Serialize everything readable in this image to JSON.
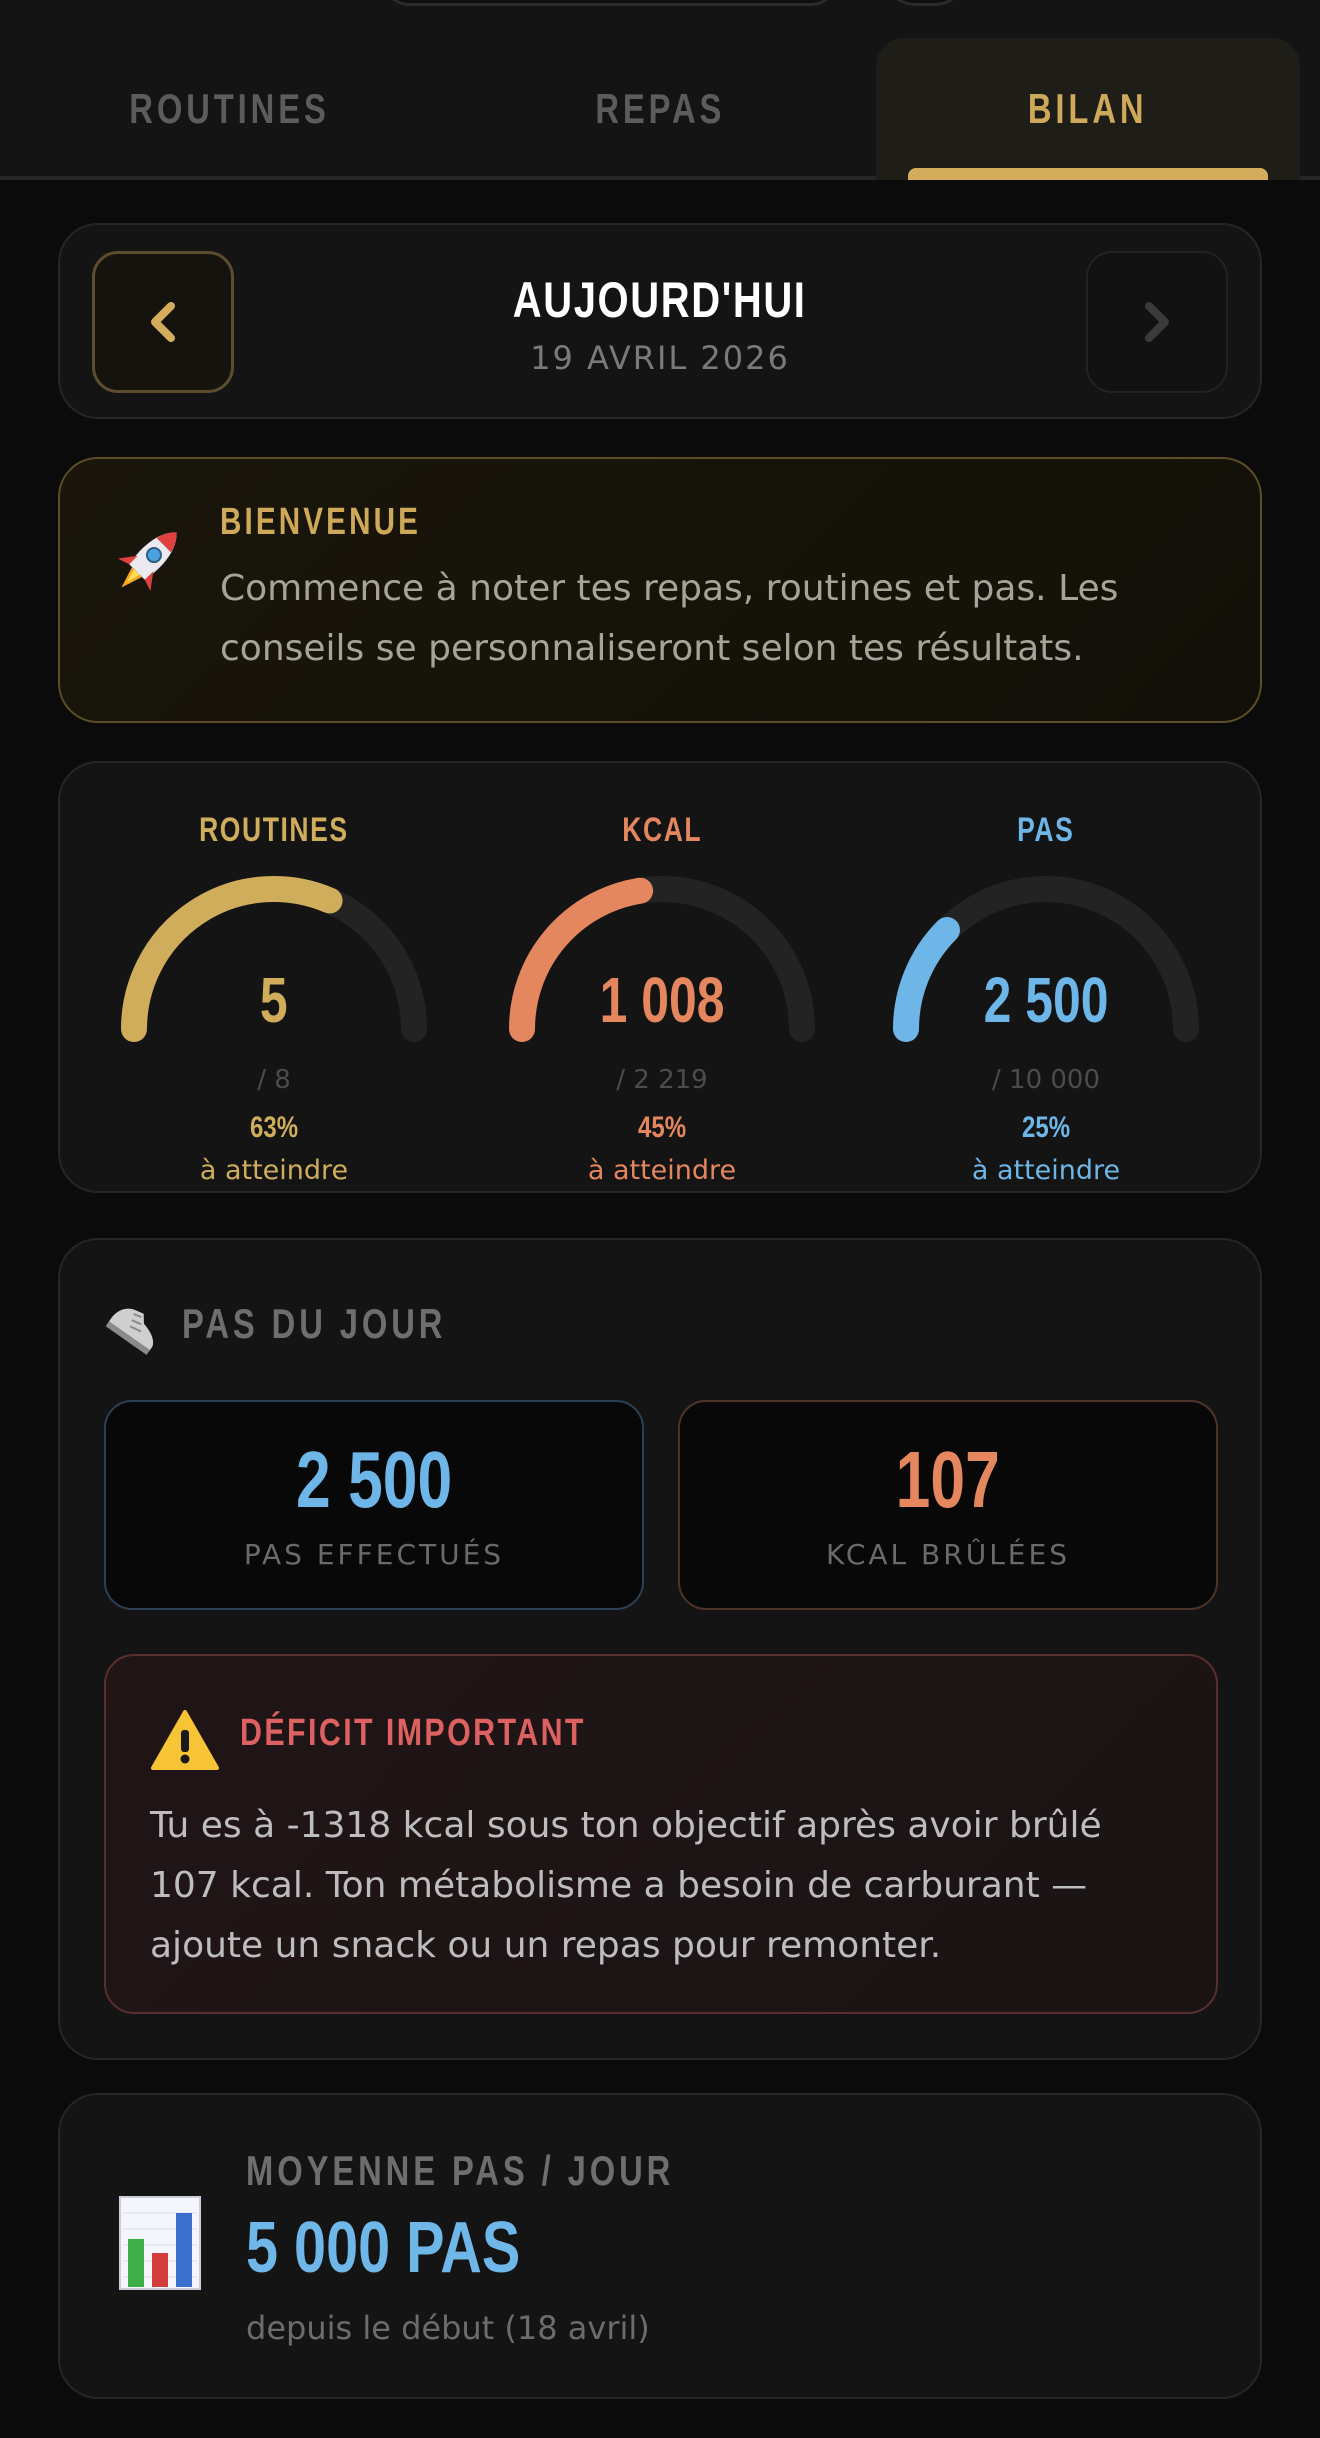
{
  "tabs": [
    {
      "label": "ROUTINES"
    },
    {
      "label": "REPAS"
    },
    {
      "label": "BILAN"
    }
  ],
  "date_nav": {
    "title": "AUJOURD'HUI",
    "date": "19 AVRIL 2026",
    "prev_icon": "chevron-left-icon",
    "next_icon": "chevron-right-icon"
  },
  "welcome": {
    "icon": "rocket-icon",
    "title": "BIENVENUE",
    "text": "Commence à noter tes repas, routines et pas. Les conseils se personnaliseront selon tes résultats."
  },
  "gauges": [
    {
      "label": "ROUTINES",
      "value": "5",
      "target": "/ 8",
      "percent_label": "63%",
      "hint": "à atteindre",
      "percent": 63,
      "color": "#cfad5b"
    },
    {
      "label": "KCAL",
      "value": "1 008",
      "target": "/ 2 219",
      "percent_label": "45%",
      "hint": "à atteindre",
      "percent": 45,
      "color": "#e4875f"
    },
    {
      "label": "PAS",
      "value": "2 500",
      "target": "/ 10 000",
      "percent_label": "25%",
      "hint": "à atteindre",
      "percent": 25,
      "color": "#6eb5e8"
    }
  ],
  "steps_card": {
    "icon": "shoe-icon",
    "title": "PAS DU JOUR",
    "steps_value": "2 500",
    "steps_label": "PAS EFFECTUÉS",
    "kcal_value": "107",
    "kcal_label": "KCAL BRÛLÉES",
    "alert": {
      "icon": "warning-icon",
      "title": "DÉFICIT IMPORTANT",
      "text": "Tu es à -1318 kcal sous ton objectif après avoir brûlé 107 kcal. Ton métabolisme a besoin de carburant — ajoute un snack ou un repas pour remonter."
    }
  },
  "average": {
    "icon": "bar-chart-icon",
    "title": "MOYENNE PAS / JOUR",
    "value": "5 000 PAS",
    "sub": "depuis le début (18 avril)"
  },
  "colors": {
    "gold": "#d3ad5c",
    "orange": "#e4875f",
    "blue": "#6eb5e8",
    "red": "#de6161",
    "background": "#0b0b0b",
    "card": "#141414"
  }
}
